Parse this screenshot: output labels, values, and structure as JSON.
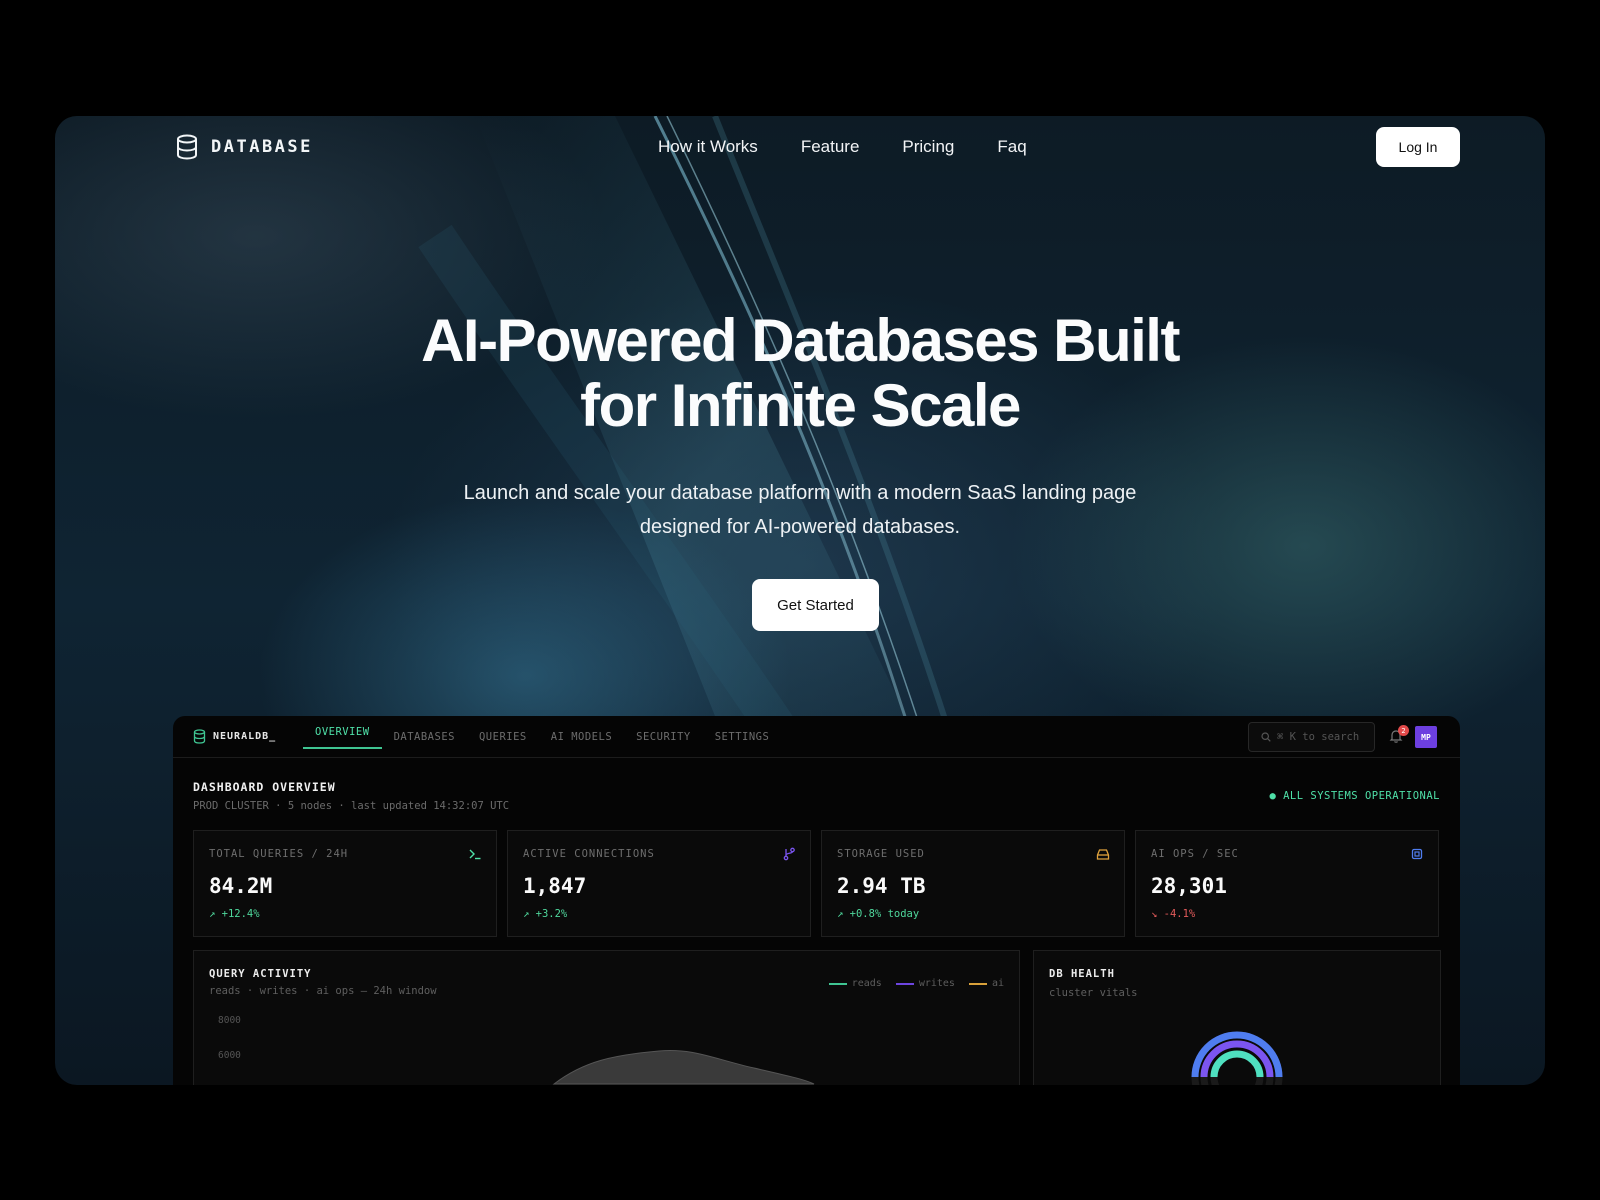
{
  "nav": {
    "logo": "DATABASE",
    "links": [
      "How it Works",
      "Feature",
      "Pricing",
      "Faq"
    ],
    "login": "Log In"
  },
  "hero": {
    "title_line1": "AI-Powered Databases Built",
    "title_line2": "for Infinite Scale",
    "subtitle_line1": "Launch and scale your database platform with a modern SaaS landing page",
    "subtitle_line2": "designed for AI-powered databases.",
    "cta": "Get Started"
  },
  "dashboard": {
    "brand": "NEURALDB_",
    "tabs": [
      "OVERVIEW",
      "DATABASES",
      "QUERIES",
      "AI MODELS",
      "SECURITY",
      "SETTINGS"
    ],
    "active_tab": "OVERVIEW",
    "search_placeholder": "⌘ K to search",
    "notification_count": "2",
    "avatar_initials": "MP",
    "title": "DASHBOARD OVERVIEW",
    "meta": "PROD CLUSTER · 5 nodes · last updated 14:32:07 UTC",
    "status": "● ALL SYSTEMS OPERATIONAL",
    "stats": [
      {
        "label": "TOTAL QUERIES / 24H",
        "value": "84.2M",
        "delta": "↗ +12.4%",
        "trend": "up",
        "icon": "terminal-icon",
        "icon_color": "#4fe0a8"
      },
      {
        "label": "ACTIVE CONNECTIONS",
        "value": "1,847",
        "delta": "↗ +3.2%",
        "trend": "up",
        "icon": "branch-icon",
        "icon_color": "#7b55f0"
      },
      {
        "label": "STORAGE USED",
        "value": "2.94 TB",
        "delta": "↗ +0.8% today",
        "trend": "up",
        "icon": "drive-icon",
        "icon_color": "#e0a23c"
      },
      {
        "label": "AI OPS / SEC",
        "value": "28,301",
        "delta": "↘ -4.1%",
        "trend": "down",
        "icon": "chip-icon",
        "icon_color": "#4f7df0"
      }
    ],
    "query_activity": {
      "title": "QUERY ACTIVITY",
      "subtitle": "reads · writes · ai ops — 24h window",
      "legend": [
        {
          "name": "reads",
          "color": "#3fc592"
        },
        {
          "name": "writes",
          "color": "#6d45e0"
        },
        {
          "name": "ai",
          "color": "#d9a13a"
        }
      ],
      "yticks": [
        "8000",
        "6000"
      ]
    },
    "db_health": {
      "title": "DB HEALTH",
      "subtitle": "cluster vitals"
    }
  }
}
